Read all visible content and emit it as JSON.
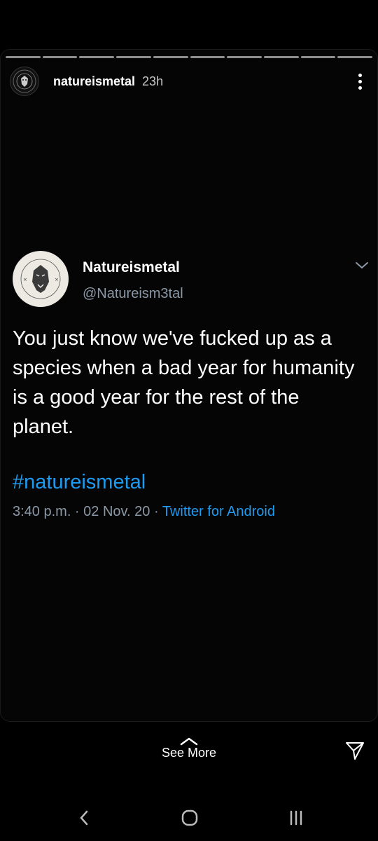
{
  "story": {
    "username": "natureismetal",
    "time_ago": "23h",
    "progress_segments": 10
  },
  "tweet": {
    "display_name": "Natureismetal",
    "handle": "@Natureism3tal",
    "text": "You just know we've fucked up as a species when a bad year for humanity is a good year for the rest of the planet.",
    "hashtag": "#natureismetal",
    "timestamp": "3:40 p.m. · 02 Nov. 20 · ",
    "source": "Twitter for Android"
  },
  "footer": {
    "see_more": "See More"
  },
  "colors": {
    "background": "#000000",
    "link_blue": "#1d9bf0",
    "meta_gray": "#8b98a5"
  },
  "icons": [
    "menu-dots-icon",
    "chevron-down-icon",
    "chevron-up-icon",
    "send-icon",
    "back-icon",
    "home-icon",
    "recents-icon"
  ]
}
